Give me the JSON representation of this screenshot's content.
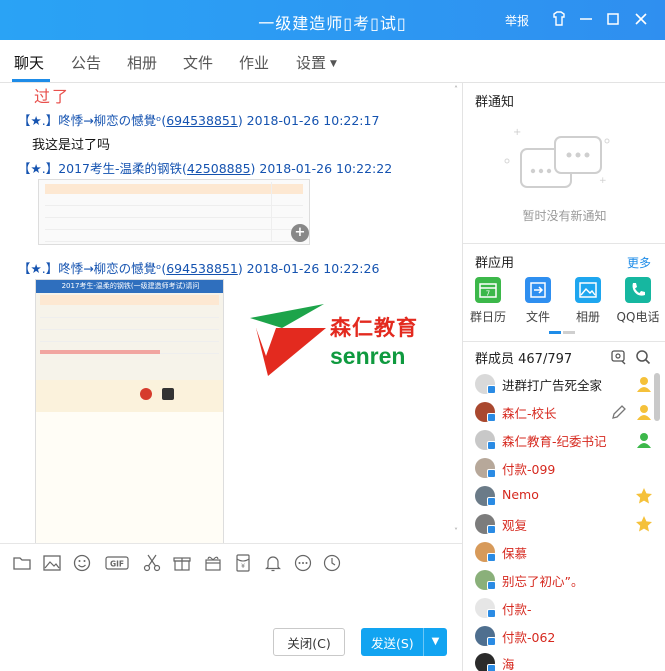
{
  "window": {
    "title": "一级建造师▯考▯试▯",
    "report_label": "举报"
  },
  "tabs": [
    {
      "label": "聊天",
      "active": true
    },
    {
      "label": "公告"
    },
    {
      "label": "相册"
    },
    {
      "label": "文件"
    },
    {
      "label": "作业"
    },
    {
      "label": "设置"
    }
  ],
  "chat": {
    "handwriting": "过了",
    "messages": [
      {
        "prefix": "【★.】",
        "name": "咚悸→柳恋の憾覺ᵒ",
        "uid": "694538851",
        "time": "2018-01-26 10:22:17",
        "text": "我这是过了吗"
      },
      {
        "prefix": "【★.】",
        "name": "2017考生-温柔的钢铁",
        "uid": "42508885",
        "time": "2018-01-26 10:22:22",
        "image": "score-table"
      },
      {
        "prefix": "【★.】",
        "name": "咚悸→柳恋の憾覺ᵒ",
        "uid": "694538851",
        "time": "2018-01-26 10:22:26",
        "image": "score-screenshot"
      }
    ],
    "screenshot_header": "2017考生-温柔的钢铁(一级建造师考试)请问",
    "logo": {
      "cn": "森仁教育",
      "en": "senren"
    }
  },
  "toolbar": [
    {
      "icon": "folder-icon"
    },
    {
      "icon": "image-icon"
    },
    {
      "icon": "emoji-icon"
    },
    {
      "icon": "gif-icon",
      "label": "GIF"
    },
    {
      "icon": "scissors-icon"
    },
    {
      "icon": "gift-box-icon"
    },
    {
      "icon": "present-icon"
    },
    {
      "icon": "red-packet-icon"
    },
    {
      "icon": "bell-icon"
    },
    {
      "icon": "more-icon"
    },
    {
      "icon": "clock-icon"
    }
  ],
  "input": {
    "close_label": "关闭(C)",
    "send_label": "发送(S)"
  },
  "right": {
    "notice_title": "群通知",
    "notice_empty": "暂时没有新通知",
    "apps_title": "群应用",
    "apps_more": "更多",
    "apps": [
      {
        "label": "群日历",
        "icon": "calendar-icon",
        "color": "#3cb84a"
      },
      {
        "label": "文件",
        "icon": "file-transfer-icon",
        "color": "#2f8ff0"
      },
      {
        "label": "相册",
        "icon": "photo-album-icon",
        "color": "#1ea6ef"
      },
      {
        "label": "QQ电话",
        "icon": "phone-icon",
        "color": "#16b7a0"
      }
    ],
    "members_title": "群成员 467/797",
    "members": [
      {
        "name": "进群打广告死全家",
        "color": "#222",
        "role": "owner"
      },
      {
        "name": "森仁-校长",
        "color": "#d6291f",
        "role": "admin",
        "edit": true
      },
      {
        "name": "森仁教育-纪委书记",
        "color": "#d6291f",
        "role": "admin-green"
      },
      {
        "name": "付款-099",
        "color": "#d6291f"
      },
      {
        "name": "Nemo",
        "color": "#d6291f",
        "role": "star"
      },
      {
        "name": "观复",
        "color": "#d6291f",
        "role": "star"
      },
      {
        "name": "保慕",
        "color": "#d6291f"
      },
      {
        "name": "别忘了初心”。",
        "color": "#d6291f"
      },
      {
        "name": "付款-",
        "color": "#d6291f"
      },
      {
        "name": "付款-062",
        "color": "#d6291f"
      },
      {
        "name": "海",
        "color": "#d6291f"
      }
    ]
  }
}
